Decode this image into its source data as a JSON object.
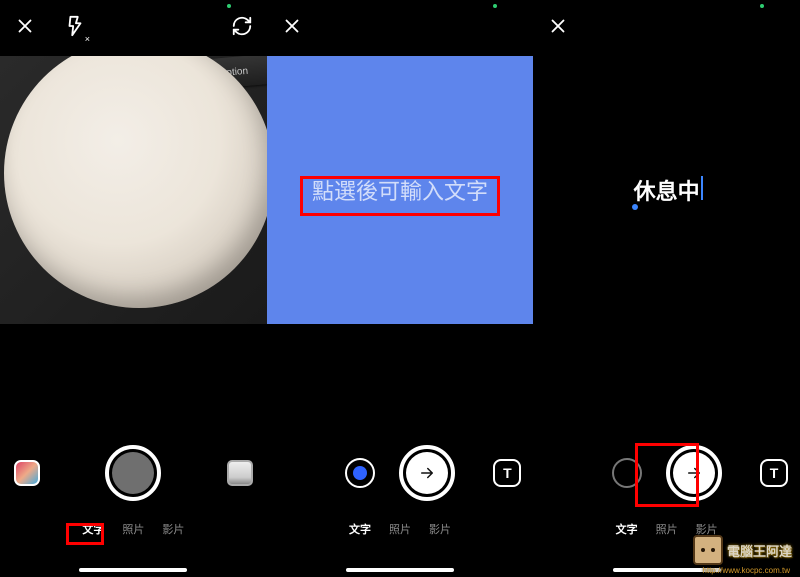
{
  "panels": [
    {
      "topbar": {
        "close": "✕",
        "flash_icon": "flash-off-icon",
        "refresh_icon": "switch-camera-icon"
      },
      "preview": {
        "option_key": "option"
      },
      "tabs": {
        "text": "文字",
        "photo": "照片",
        "video": "影片",
        "active": "text"
      }
    },
    {
      "topbar": {
        "close": "✕"
      },
      "canvas": {
        "placeholder": "點選後可輸入文字"
      },
      "tabs": {
        "text": "文字",
        "photo": "照片",
        "video": "影片",
        "active": "text"
      }
    },
    {
      "topbar": {
        "close": "✕"
      },
      "canvas": {
        "value": "休息中"
      },
      "tabs": {
        "text": "文字",
        "photo": "照片",
        "video": "影片",
        "active": "text"
      }
    }
  ],
  "watermark": {
    "name": "電腦王阿達",
    "url": "http://www.kocpc.com.tw"
  }
}
